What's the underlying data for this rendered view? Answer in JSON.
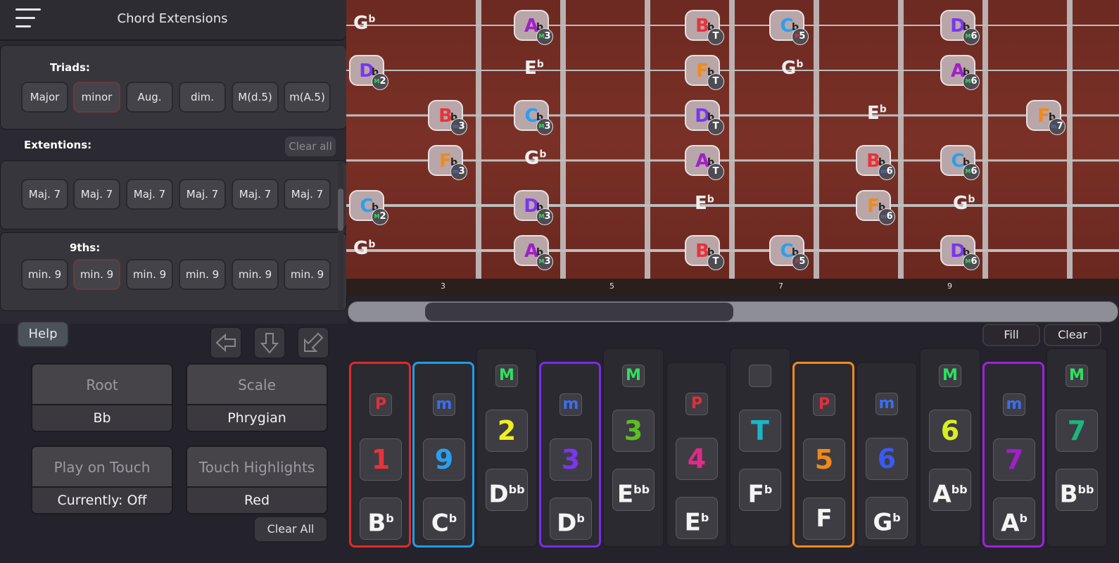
{
  "header": {
    "title": "Chord Extensions"
  },
  "triads": {
    "label": "Triads:",
    "buttons": [
      "Major",
      "minor",
      "Aug.",
      "dim.",
      "M(d.5)",
      "m(A.5)"
    ]
  },
  "extensions": {
    "label": "Extentions:",
    "clear_all": "Clear all",
    "seventh_buttons": [
      "Maj. 7",
      "Maj. 7",
      "Maj. 7",
      "Maj. 7",
      "Maj. 7",
      "Maj. 7"
    ],
    "ninths_label": "9ths:",
    "ninth_buttons": [
      "min. 9",
      "min. 9",
      "min. 9",
      "min. 9",
      "min. 9",
      "min. 9"
    ]
  },
  "controls": {
    "help": "Help",
    "root": {
      "label": "Root",
      "value": "Bb"
    },
    "scale": {
      "label": "Scale",
      "value": "Phrygian"
    },
    "play_on_touch": {
      "label": "Play on Touch",
      "value": "Currently: Off"
    },
    "touch_highlights": {
      "label": "Touch Highlights",
      "value": "Red"
    },
    "clear_all": "Clear All"
  },
  "fret_numbers": [
    "3",
    "5",
    "7",
    "9"
  ],
  "fill_clear": {
    "fill": "Fill",
    "clear": "Clear"
  },
  "degrees": [
    {
      "quality": "P",
      "number": "1",
      "note": "B",
      "acc": "b",
      "highlight": "#e02a2a",
      "qcolor": "#e0303a",
      "ncolor": "#e8323a"
    },
    {
      "quality": "m",
      "number": "9",
      "note": "C",
      "acc": "b",
      "highlight": "#1e9de8",
      "qcolor": "#3a6ef0",
      "ncolor": "#2a9ff0"
    },
    {
      "quality": "M",
      "number": "2",
      "note": "D",
      "acc": "bb",
      "highlight": "",
      "qcolor": "#2ee060",
      "ncolor": "#f0f020"
    },
    {
      "quality": "m",
      "number": "3",
      "note": "D",
      "acc": "b",
      "highlight": "#7a2af0",
      "qcolor": "#3a6ef0",
      "ncolor": "#7a36f0"
    },
    {
      "quality": "M",
      "number": "3",
      "note": "E",
      "acc": "bb",
      "highlight": "",
      "qcolor": "#2ee060",
      "ncolor": "#5ac020"
    },
    {
      "quality": "P",
      "number": "4",
      "note": "E",
      "acc": "b",
      "highlight": "",
      "qcolor": "#e0303a",
      "ncolor": "#e02a8a"
    },
    {
      "quality": "",
      "number": "T",
      "note": "F",
      "acc": "b",
      "highlight": "",
      "qcolor": "#888",
      "ncolor": "#1ab6c8"
    },
    {
      "quality": "P",
      "number": "5",
      "note": "F",
      "acc": "",
      "highlight": "#f08a1a",
      "qcolor": "#e0303a",
      "ncolor": "#f08a1a"
    },
    {
      "quality": "m",
      "number": "6",
      "note": "G",
      "acc": "b",
      "highlight": "",
      "qcolor": "#3a6ef0",
      "ncolor": "#3a5af0"
    },
    {
      "quality": "M",
      "number": "6",
      "note": "A",
      "acc": "bb",
      "highlight": "",
      "qcolor": "#2ee060",
      "ncolor": "#d8f020"
    },
    {
      "quality": "m",
      "number": "7",
      "note": "A",
      "acc": "b",
      "highlight": "#a020e0",
      "qcolor": "#3a6ef0",
      "ncolor": "#a020c8"
    },
    {
      "quality": "M",
      "number": "7",
      "note": "B",
      "acc": "bb",
      "highlight": "",
      "qcolor": "#2ee060",
      "ncolor": "#18b880"
    }
  ],
  "fretboard_notes": [
    {
      "letter": "A",
      "acc": "b",
      "degree": "3",
      "dq": "M",
      "color": "#a020c8"
    },
    {
      "letter": "B",
      "acc": "b",
      "degree": "T",
      "dq": "",
      "color": "#e8323a"
    },
    {
      "letter": "C",
      "acc": "b",
      "degree": "5",
      "dq": "P",
      "color": "#2a9ff0"
    },
    {
      "letter": "D",
      "acc": "b",
      "degree": "6",
      "dq": "M",
      "color": "#7a36f0"
    },
    {
      "letter": "D",
      "acc": "b",
      "degree": "2",
      "dq": "M",
      "color": "#7a36f0"
    },
    {
      "letter": "F",
      "acc": "b",
      "degree": "T",
      "dq": "",
      "color": "#f08a1a"
    },
    {
      "letter": "A",
      "acc": "b",
      "degree": "6",
      "dq": "M",
      "color": "#a020c8"
    },
    {
      "letter": "B",
      "acc": "b",
      "degree": "3",
      "dq": "m",
      "color": "#e8323a"
    },
    {
      "letter": "C",
      "acc": "b",
      "degree": "3",
      "dq": "M",
      "color": "#2a9ff0"
    },
    {
      "letter": "D",
      "acc": "b",
      "degree": "T",
      "dq": "",
      "color": "#7a36f0"
    },
    {
      "letter": "F",
      "acc": "b",
      "degree": "7",
      "dq": "m",
      "color": "#f08a1a"
    },
    {
      "letter": "F",
      "acc": "b",
      "degree": "3",
      "dq": "m",
      "color": "#f08a1a"
    },
    {
      "letter": "A",
      "acc": "b",
      "degree": "T",
      "dq": "",
      "color": "#a020c8"
    },
    {
      "letter": "B",
      "acc": "b",
      "degree": "6",
      "dq": "m",
      "color": "#e8323a"
    },
    {
      "letter": "C",
      "acc": "b",
      "degree": "6",
      "dq": "M",
      "color": "#2a9ff0"
    },
    {
      "letter": "C",
      "acc": "b",
      "degree": "2",
      "dq": "M",
      "color": "#2a9ff0"
    },
    {
      "letter": "D",
      "acc": "b",
      "degree": "3",
      "dq": "M",
      "color": "#7a36f0"
    },
    {
      "letter": "F",
      "acc": "b",
      "degree": "6",
      "dq": "m",
      "color": "#f08a1a"
    },
    {
      "letter": "A",
      "acc": "b",
      "degree": "3",
      "dq": "M",
      "color": "#a020c8"
    },
    {
      "letter": "B",
      "acc": "b",
      "degree": "T",
      "dq": "",
      "color": "#e8323a"
    },
    {
      "letter": "C",
      "acc": "b",
      "degree": "5",
      "dq": "P",
      "color": "#2a9ff0"
    },
    {
      "letter": "D",
      "acc": "b",
      "degree": "6",
      "dq": "M",
      "color": "#7a36f0"
    }
  ],
  "fretboard_plain": [
    {
      "letter": "G",
      "acc": "b"
    },
    {
      "letter": "E",
      "acc": "b"
    },
    {
      "letter": "G",
      "acc": "b"
    },
    {
      "letter": "E",
      "acc": "b"
    },
    {
      "letter": "G",
      "acc": "b"
    },
    {
      "letter": "E",
      "acc": "b"
    },
    {
      "letter": "G",
      "acc": "b"
    },
    {
      "letter": "G",
      "acc": "b"
    }
  ]
}
